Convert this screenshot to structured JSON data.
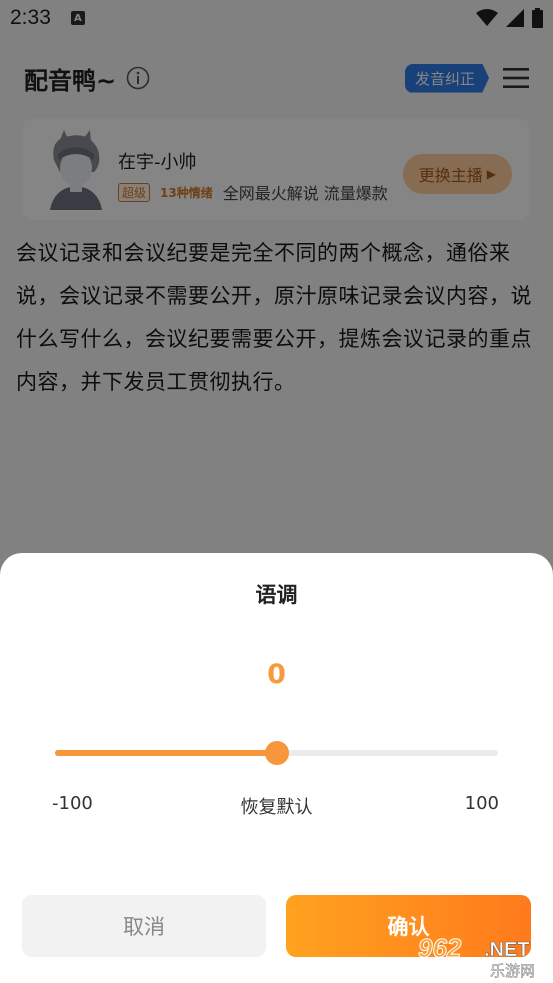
{
  "status_bar": {
    "time": "2:33",
    "notification_badge": "A"
  },
  "app_bar": {
    "title": "配音鸭~",
    "fix_button": "发音纠正"
  },
  "voice_card": {
    "name": "在宇-小帅",
    "tier": "超级",
    "emotions": "13种情绪",
    "description": "全网最火解说 流量爆款",
    "swap_button": "更换主播"
  },
  "main_text": "会议记录和会议纪要是完全不同的两个概念，通俗来说，会议记录不需要公开，原汁原味记录会议内容，说什么写什么，会议纪要需要公开，提炼会议记录的重点内容，并下发员工贯彻执行。",
  "pitch_sheet": {
    "title": "语调",
    "value": "0",
    "min_label": "-100",
    "max_label": "100",
    "reset_label": "恢复默认",
    "slider": {
      "min": -100,
      "max": 100,
      "value": 0
    },
    "cancel_button": "取消",
    "confirm_button": "确认"
  },
  "watermark": {
    "top": "962",
    "suffix": ".NET",
    "bottom": "乐游网"
  },
  "colors": {
    "accent": "#f7963a",
    "brand_blue": "#2f7be8"
  }
}
